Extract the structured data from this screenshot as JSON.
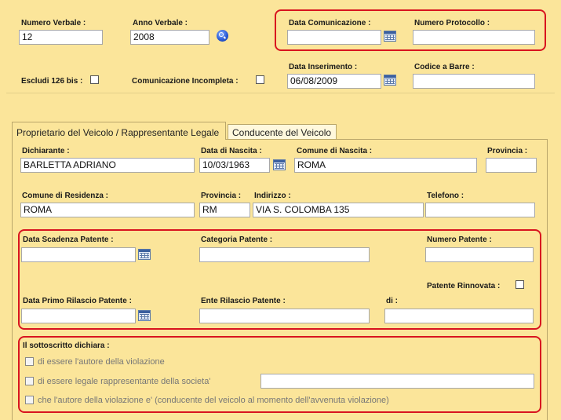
{
  "header": {
    "numero_verbale": {
      "label": "Numero Verbale :",
      "value": "12"
    },
    "anno_verbale": {
      "label": "Anno Verbale :",
      "value": "2008"
    },
    "data_comunicazione": {
      "label": "Data Comunicazione :",
      "value": ""
    },
    "numero_protocollo": {
      "label": "Numero Protocollo :",
      "value": ""
    },
    "escludi_126_bis": {
      "label": "Escludi 126 bis :"
    },
    "comunicazione_incompleta": {
      "label": "Comunicazione Incompleta :"
    },
    "data_inserimento": {
      "label": "Data Inserimento :",
      "value": "06/08/2009"
    },
    "codice_a_barre": {
      "label": "Codice a Barre :",
      "value": ""
    }
  },
  "tabs": [
    {
      "label": "Proprietario del Veicolo / Rappresentante Legale",
      "active": true
    },
    {
      "label": "Conducente del Veicolo",
      "active": false
    }
  ],
  "owner": {
    "dichiarante": {
      "label": "Dichiarante :",
      "value": "BARLETTA ADRIANO"
    },
    "data_nascita": {
      "label": "Data di Nascita :",
      "value": "10/03/1963"
    },
    "comune_nascita": {
      "label": "Comune di Nascita :",
      "value": "ROMA"
    },
    "provincia_nascita": {
      "label": "Provincia :",
      "value": ""
    },
    "comune_residenza": {
      "label": "Comune di Residenza :",
      "value": "ROMA"
    },
    "provincia_residenza": {
      "label": "Provincia :",
      "value": "RM"
    },
    "indirizzo": {
      "label": "Indirizzo :",
      "value": "VIA S. COLOMBA 135"
    },
    "telefono": {
      "label": "Telefono :",
      "value": ""
    }
  },
  "patente": {
    "data_scadenza": {
      "label": "Data Scadenza Patente :",
      "value": ""
    },
    "categoria": {
      "label": "Categoria Patente :",
      "value": ""
    },
    "numero": {
      "label": "Numero Patente :",
      "value": ""
    },
    "rinnovata": {
      "label": "Patente Rinnovata :"
    },
    "data_primo_rilascio": {
      "label": "Data Primo Rilascio Patente :",
      "value": ""
    },
    "ente_rilascio": {
      "label": "Ente Rilascio Patente :",
      "value": ""
    },
    "di": {
      "label": "di :",
      "value": ""
    }
  },
  "dichiara": {
    "title": "Il sottoscritto dichiara :",
    "options": [
      {
        "label": "di essere l'autore della violazione"
      },
      {
        "label": "di essere legale rappresentante della societa'",
        "value": ""
      },
      {
        "label": "che l'autore della violazione e' (conducente del veicolo al momento dell'avvenuta violazione)"
      }
    ]
  }
}
